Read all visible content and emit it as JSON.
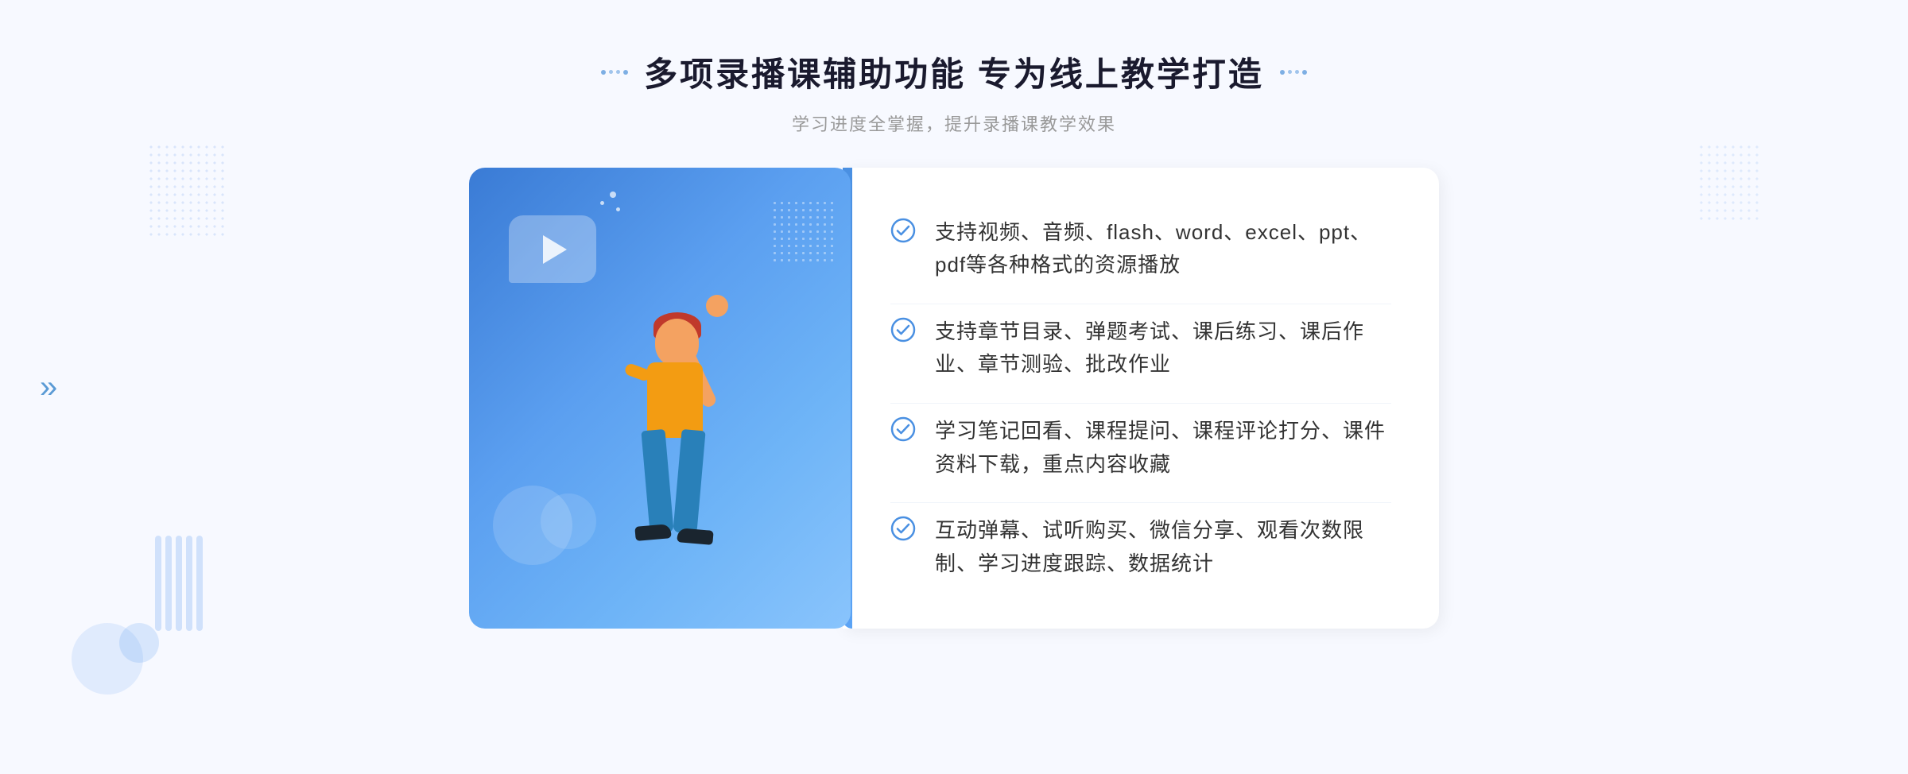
{
  "page": {
    "background_color": "#f5f8fe"
  },
  "header": {
    "title": "多项录播课辅助功能 专为线上教学打造",
    "subtitle": "学习进度全掌握，提升录播课教学效果",
    "title_decorator_left": "⠿",
    "title_decorator_right": "⠿"
  },
  "features": [
    {
      "id": 1,
      "text": "支持视频、音频、flash、word、excel、ppt、pdf等各种格式的资源播放"
    },
    {
      "id": 2,
      "text": "支持章节目录、弹题考试、课后练习、课后作业、章节测验、批改作业"
    },
    {
      "id": 3,
      "text": "学习笔记回看、课程提问、课程评论打分、课件资料下载，重点内容收藏"
    },
    {
      "id": 4,
      "text": "互动弹幕、试听购买、微信分享、观看次数限制、学习进度跟踪、数据统计"
    }
  ],
  "icons": {
    "check": "check-circle-icon",
    "play": "play-icon",
    "chevron_left": "«",
    "check_symbol": "✓"
  },
  "colors": {
    "primary_blue": "#4a90e2",
    "light_blue": "#5ba3f5",
    "accent_blue": "#3a7bd5",
    "text_dark": "#333333",
    "text_gray": "#999999",
    "background": "#f5f8fe",
    "white": "#ffffff",
    "check_blue": "#4a90e2"
  }
}
